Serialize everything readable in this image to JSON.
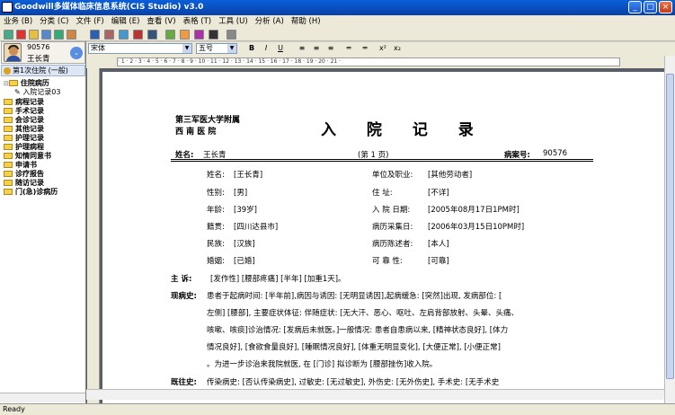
{
  "window": {
    "title": "Goodwill多媒体临床信息系统(CIS Studio) v3.0"
  },
  "menu": [
    "业务 (B)",
    "分类 (C)",
    "文件 (F)",
    "编辑 (E)",
    "查看 (V)",
    "表格 (T)",
    "工具 (U)",
    "分析 (A)",
    "帮助 (H)"
  ],
  "format": {
    "font": "宋体",
    "size": "五号",
    "bold": "B",
    "italic": "I",
    "underline": "U",
    "superscript": "x²",
    "subscript": "x₂"
  },
  "patient": {
    "id": "90576",
    "name": "王长青",
    "visit": "第1次住院 (一般)"
  },
  "tree": {
    "root": "住院病历",
    "child": "入院记录03",
    "folders": [
      "病程记录",
      "手术记录",
      "会诊记录",
      "其他记录",
      "护理记录",
      "护理病程",
      "知情同意书",
      "申请书",
      "诊疗报告",
      "随访记录",
      "门(急)诊病历"
    ]
  },
  "ruler": "· 1 · 2 · 3 · 4 · 5 · 6 · 7 · 8 · 9 · 10 · 11 · 12 · 13 · 14 · 15 · 16 · 17 · 18 · 19 · 20 · 21 ·",
  "doc": {
    "hospital_line1": "第三军医大学附属",
    "hospital_line2": "西  南  医  院",
    "title": "入 院 记 录",
    "name_label": "姓名:",
    "name_value": "王长青",
    "page": "(第  1  页)",
    "record_label": "病案号:",
    "record_value": "90576",
    "left_fields": [
      {
        "label": "姓名:",
        "value": "[王长青]"
      },
      {
        "label": "性别:",
        "value": "[男]"
      },
      {
        "label": "年龄:",
        "value": "[39岁]"
      },
      {
        "label": "籍贯:",
        "value": "[四川达县市]"
      },
      {
        "label": "民族:",
        "value": "[汉族]"
      },
      {
        "label": "婚姻:",
        "value": "[已婚]"
      }
    ],
    "right_fields": [
      {
        "label": "单位及职业:",
        "value": "[其他劳动者]"
      },
      {
        "label": "住      址:",
        "value": "[不详]"
      },
      {
        "label": "入 院 日期:",
        "value": "[2005年08月17日1PM时]"
      },
      {
        "label": "病历采集日:",
        "value": "[2006年03月15日10PM时]"
      },
      {
        "label": "病历陈述者:",
        "value": "[本人]"
      },
      {
        "label": "可  靠  性:",
        "value": "[可靠]"
      }
    ],
    "complaint_label": "主   诉:",
    "complaint": "[发作性] [腰部疼痛] [半年] [加重1天]。",
    "history_label": "现病史:",
    "history_lines": [
      "患者于起病时间: [半年前],病因与诱因: [无明显诱因],起病缓急: [突然]出现, 发病部位: [",
      "左侧] [腰部], 主要症状体征: 伴随症状: [无大汗、恶心、呕吐、左肩背部放射、头晕、头痛、",
      "咳嗽、咳痰]诊治情况: [发病后未就医。]一般情况: 患者自患病以来, [精神状态良好], [体力",
      "情况良好], [食欲食量良好], [睡眠情况良好], [体重无明显变化], [大便正常], [小便正常]",
      "。为进一步诊治来我院就医, 在 [门诊] 拟诊断为 [腰部挫伤]收入院。"
    ],
    "past_label": "既往史:",
    "past": "传染病史: [否认传染病史], 过敏史: [无过敏史], 外伤史: [无外伤史], 手术史: [无手术史"
  },
  "status": "Ready"
}
